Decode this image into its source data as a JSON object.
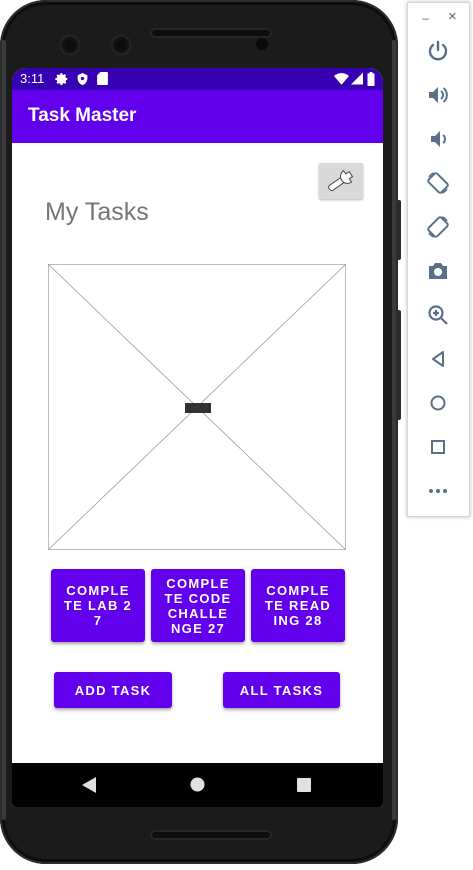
{
  "status_bar": {
    "time": "3:11"
  },
  "app_bar": {
    "title": "Task Master"
  },
  "main": {
    "page_title": "My Tasks",
    "image_placeholder_label": "",
    "task_buttons": [
      {
        "label": "COMPLETE LAB 27"
      },
      {
        "label": "COMPLETE CODE CHALLENGE 27"
      },
      {
        "label": "COMPLETE READING 28"
      }
    ],
    "add_task_label": "ADD TASK",
    "all_tasks_label": "ALL TASKS"
  },
  "emulator_panel": {
    "minimize_label": "–",
    "close_label": "×",
    "tools": [
      "power-icon",
      "volume-up-icon",
      "volume-down-icon",
      "rotate-left-icon",
      "rotate-right-icon",
      "camera-icon",
      "zoom-icon",
      "back-icon",
      "home-icon",
      "overview-icon",
      "more-icon"
    ]
  },
  "colors": {
    "primary": "#6200ee",
    "primary_dark": "#3700b3",
    "panel_icon": "#5a6f8a"
  }
}
